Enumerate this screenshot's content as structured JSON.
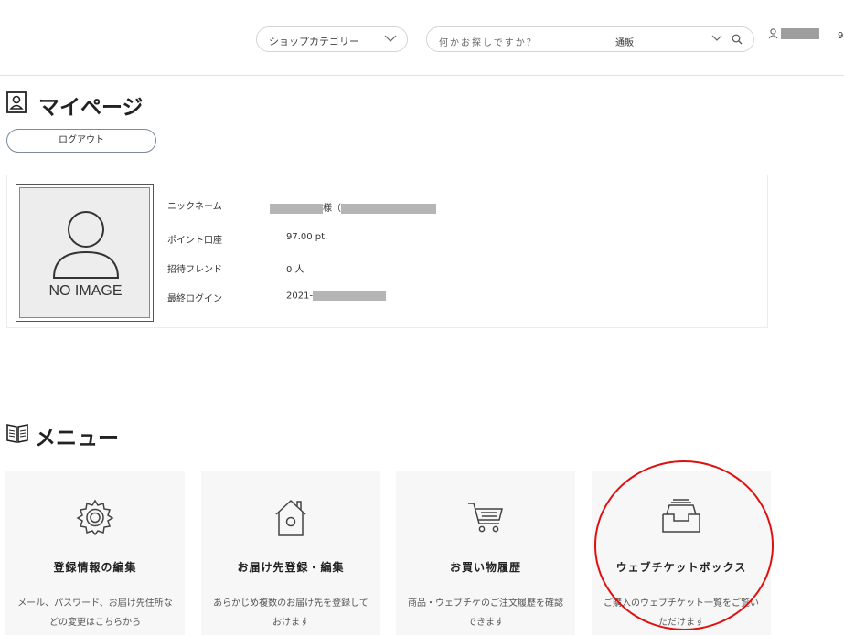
{
  "header": {
    "shop_category_label": "ショップカテゴリー",
    "search_placeholder": "何かお探しですか？",
    "search_scope": "通販",
    "user_trunc": "9"
  },
  "page": {
    "title": "マイページ",
    "logout_label": "ログアウト"
  },
  "profile": {
    "avatar_text": "NO IMAGE",
    "rows": [
      {
        "key": "ニックネーム",
        "value_suffix": "様（"
      },
      {
        "key": "ポイント口座",
        "value": "97.00 pt."
      },
      {
        "key": "招待フレンド",
        "value": "0 人"
      },
      {
        "key": "最終ログイン",
        "value": "2021-"
      }
    ]
  },
  "menu": {
    "title": "メニュー",
    "cards": [
      {
        "title": "登録情報の編集",
        "desc": "メール、パスワード、お届け先住所などの変更はこちらから",
        "icon": "gear-icon"
      },
      {
        "title": "お届け先登録・編集",
        "desc": "あらかじめ複数のお届け先を登録しておけます",
        "icon": "house-icon"
      },
      {
        "title": "お買い物履歴",
        "desc": "商品・ウェブチケのご注文履歴を確認できます",
        "icon": "cart-icon"
      },
      {
        "title": "ウェブチケットボックス",
        "desc": "ご購入のウェブチケット一覧をご覧いただけます",
        "icon": "inbox-tray-icon"
      }
    ]
  },
  "colors": {
    "annotation_circle": "#e01010",
    "card_bg": "#f7f7f7"
  }
}
